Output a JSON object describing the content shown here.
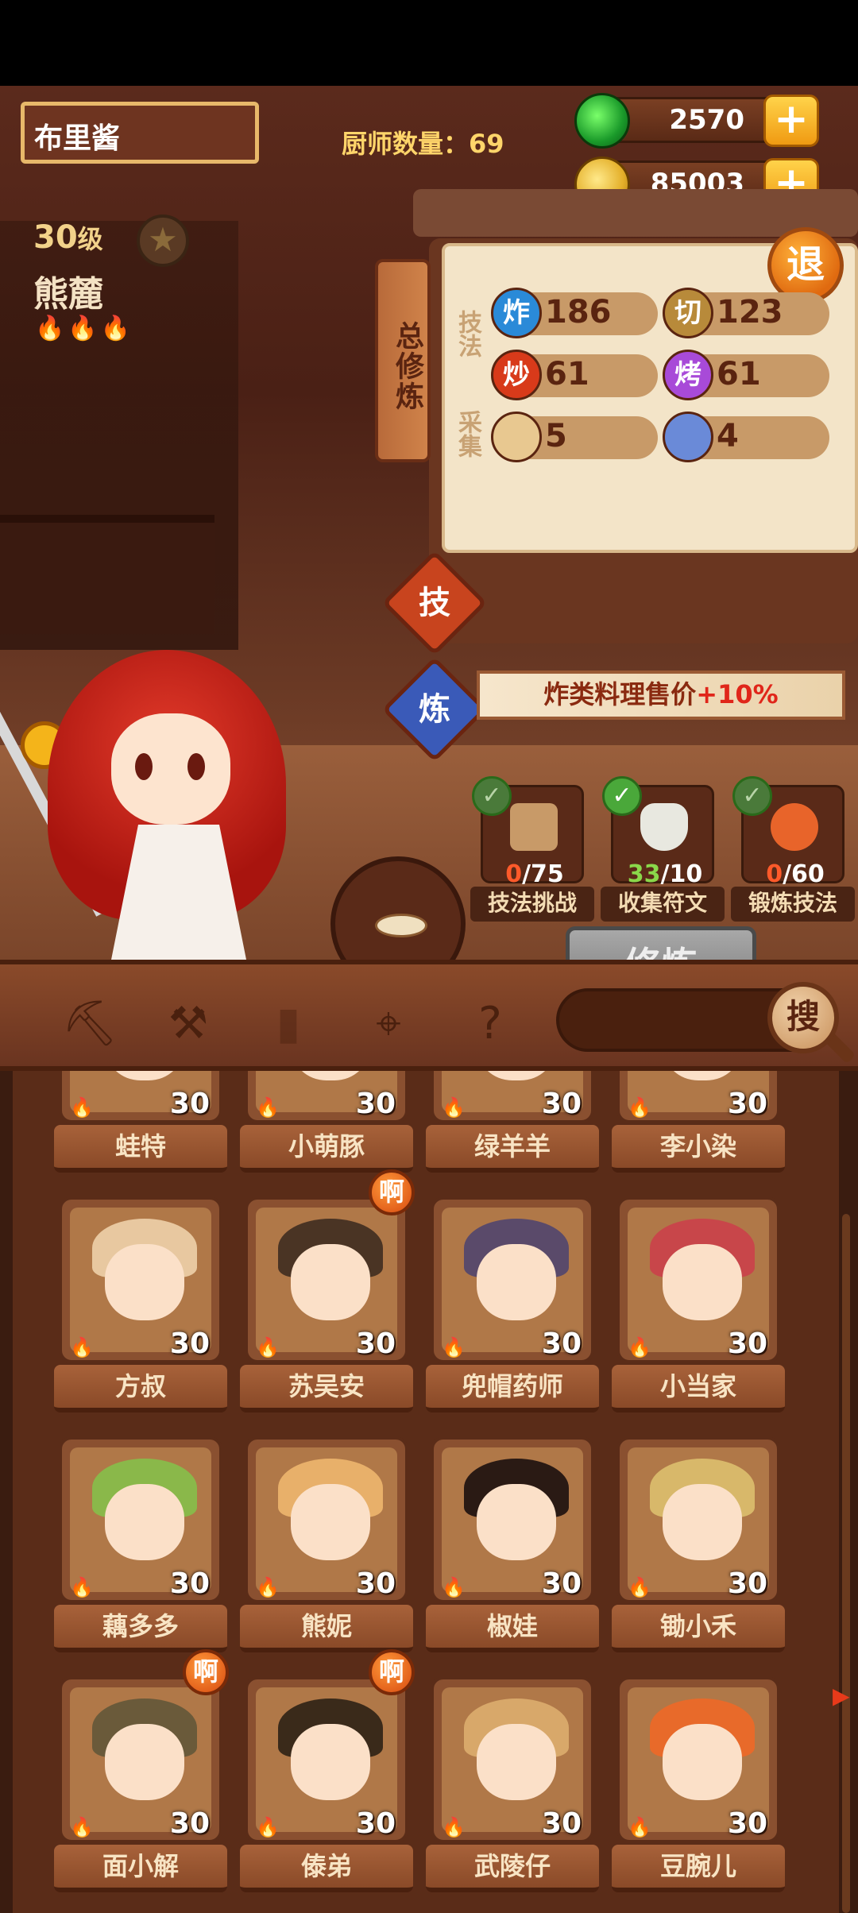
{
  "player_name": "布里酱",
  "chef_count_label": "厨师数量：",
  "chef_count": "69",
  "currency": {
    "gem_amount": "2570",
    "coin_amount": "85003",
    "plus_label": "+"
  },
  "chef": {
    "level": "30",
    "level_unit": "级",
    "name": "熊麓",
    "flames": "🔥🔥🔥",
    "star_icon": "★"
  },
  "panel": {
    "tab_label": "总修炼",
    "exit_label": "退",
    "skills_category": "技法",
    "gather_category": "采集",
    "stats": [
      {
        "icon": "炸",
        "value": "186",
        "color": "#2a8ad8"
      },
      {
        "icon": "切",
        "value": "123",
        "color": "#b88a3a"
      },
      {
        "icon": "炒",
        "value": "61",
        "color": "#d83a1a"
      },
      {
        "icon": "烤",
        "value": "61",
        "color": "#a84ad8"
      },
      {
        "icon": "",
        "value": "5",
        "color": "#e8c890",
        "name": "bun-icon"
      },
      {
        "icon": "",
        "value": "4",
        "color": "#6a8ad8",
        "name": "fish-icon"
      }
    ],
    "skill_tab": "技",
    "refine_tab": "炼",
    "bonus_text": "炸类料理售价",
    "bonus_value": "+10%",
    "tasks": [
      {
        "current": "0",
        "total": "/75",
        "label": "技法挑战",
        "done": false
      },
      {
        "current": "33",
        "total": "/10",
        "label": "收集符文",
        "done": true
      },
      {
        "current": "0",
        "total": "/60",
        "label": "锻炼技法",
        "done": false
      }
    ],
    "cultivate_label": "修炼"
  },
  "toolbar": {
    "search_label": "搜"
  },
  "chefs": [
    {
      "name": "蛙特",
      "level": "30"
    },
    {
      "name": "小萌豚",
      "level": "30"
    },
    {
      "name": "绿羊羊",
      "level": "30"
    },
    {
      "name": "李小染",
      "level": "30"
    },
    {
      "name": "方叔",
      "level": "30"
    },
    {
      "name": "苏吴安",
      "level": "30",
      "badge": "啊"
    },
    {
      "name": "兜帽药师",
      "level": "30"
    },
    {
      "name": "小当家",
      "level": "30"
    },
    {
      "name": "藕多多",
      "level": "30"
    },
    {
      "name": "熊妮",
      "level": "30"
    },
    {
      "name": "椒娃",
      "level": "30"
    },
    {
      "name": "锄小禾",
      "level": "30"
    },
    {
      "name": "面小解",
      "level": "30",
      "badge": "啊"
    },
    {
      "name": "傣弟",
      "level": "30",
      "badge": "啊"
    },
    {
      "name": "武陵仔",
      "level": "30"
    },
    {
      "name": "豆腕儿",
      "level": "30"
    }
  ],
  "colors": {
    "accent_gold": "#ffd56a",
    "wood_dark": "#5a2c18",
    "button_disabled": "#8a8a8a"
  }
}
